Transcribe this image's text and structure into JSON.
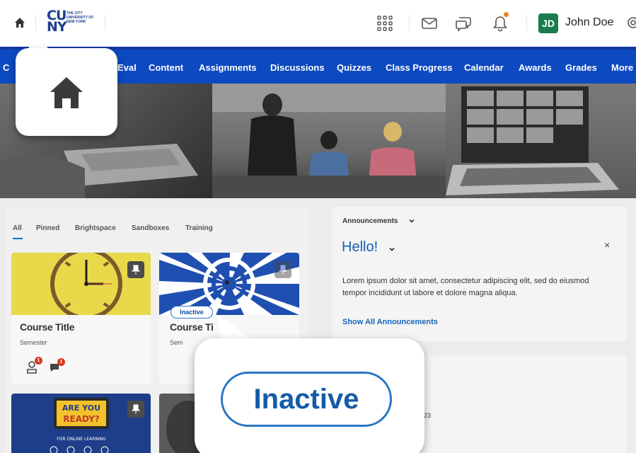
{
  "header": {
    "logo": {
      "main_top": "CU",
      "main_bottom": "NY",
      "sub": "THE CITY UNIVERSITY OF NEW YORK"
    },
    "user": {
      "initials": "JD",
      "name": "John Doe"
    }
  },
  "nav": {
    "items": [
      "C",
      "Eval",
      "Content",
      "Assignments",
      "Discussions",
      "Quizzes",
      "Class Progress",
      "Calendar",
      "Awards",
      "Grades",
      "More"
    ]
  },
  "courses": {
    "tabs": [
      "All",
      "Pinned",
      "Brightspace",
      "Sandboxes",
      "Training"
    ],
    "cards": [
      {
        "title": "Course Title",
        "semester": "Semester",
        "badge_1": "1",
        "badge_2": "1"
      },
      {
        "title": "Course Ti",
        "semester": "Sem",
        "status": "Inactive"
      }
    ],
    "card3_image_text": {
      "line1": "ARE YOU",
      "line2": "READY?",
      "line3": "FOR ONLINE LEARNING"
    }
  },
  "announcements": {
    "header": "Announcements",
    "title": "Hello!",
    "close": "×",
    "body": "Lorem ipsum dolor sit amet, consectetur adipiscing elit, sed do eiusmod tempor incididunt ut labore et dolore magna aliqua.",
    "show_all": "Show All Announcements",
    "partial_date": "023"
  },
  "callouts": {
    "inactive_label": "Inactive"
  },
  "colors": {
    "nav_bg": "#0d49c0",
    "accent": "#1460b8",
    "avatar": "#1a7c4a",
    "notification": "#f08120"
  }
}
